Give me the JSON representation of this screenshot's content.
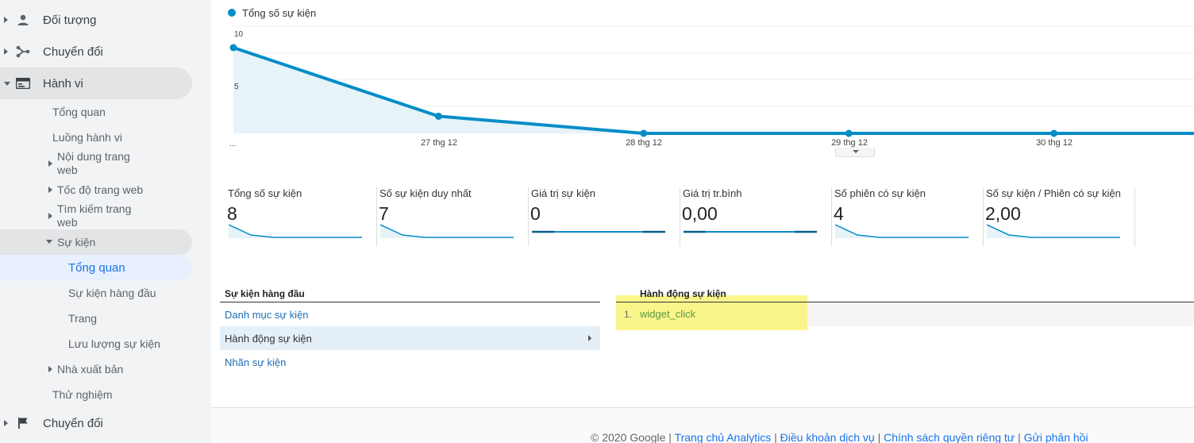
{
  "sidebar": {
    "top_items": [
      {
        "label": "Đối tượng",
        "icon": "person-icon"
      },
      {
        "label": "Chuyển đổi",
        "icon": "fork-icon"
      },
      {
        "label": "Hành vi",
        "icon": "behavior-icon"
      },
      {
        "label": "Chuyển đổi",
        "icon": "flag-icon"
      }
    ],
    "behavior_items": {
      "overview": "Tổng quan",
      "flow": "Luồng hành vi",
      "site_content_1": "Nội dung trang",
      "site_content_2": "web",
      "site_speed": "Tốc độ trang web",
      "site_search_1": "Tìm kiếm trang",
      "site_search_2": "web",
      "events": "Sự kiện",
      "events_overview": "Tổng quan",
      "top_events": "Sự kiện hàng đầu",
      "pages": "Trang",
      "events_flow": "Lưu lượng sự kiện",
      "publisher": "Nhà xuất bản",
      "experiments": "Thử nghiệm"
    }
  },
  "chart": {
    "legend": "Tổng số sự kiện",
    "y_ticks": [
      "10",
      "5",
      "..."
    ],
    "x_labels": [
      "27 thg 12",
      "28 thg 12",
      "29 thg 12",
      "30 thg 12"
    ]
  },
  "chart_data": {
    "type": "area",
    "series": [
      {
        "name": "Tổng số sự kiện",
        "values": [
          8,
          1.6,
          0,
          0,
          0
        ]
      }
    ],
    "ylim": [
      0,
      10
    ],
    "line_color": "#058dc7"
  },
  "metrics": [
    {
      "label": "Tổng số sự kiện",
      "value": "8",
      "spark": "decay"
    },
    {
      "label": "Số sự kiện duy nhất",
      "value": "7",
      "spark": "decay"
    },
    {
      "label": "Giá trị sự kiện",
      "value": "0",
      "spark": "flat"
    },
    {
      "label": "Giá trị tr.bình",
      "value": "0,00",
      "spark": "flat"
    },
    {
      "label": "Số phiên có sự kiện",
      "value": "4",
      "spark": "decay"
    },
    {
      "label": "Số sự kiện / Phiên có sự kiện",
      "value": "2,00",
      "spark": "decay"
    }
  ],
  "top_events": {
    "title": "Sự kiện hàng đầu",
    "rows": [
      "Danh mục sự kiện",
      "Hành động sự kiện",
      "Nhãn sự kiện"
    ]
  },
  "event_action": {
    "title": "Hành động sự kiện",
    "rows": [
      {
        "num": "1.",
        "value": "widget_click"
      }
    ]
  },
  "footer": {
    "copyright": "© 2020 Google",
    "sep": " | ",
    "links": [
      "Trang chủ Analytics",
      "Điều khoản dịch vụ",
      "Chính sách quyền riêng tư",
      "Gửi phản hồi"
    ]
  }
}
